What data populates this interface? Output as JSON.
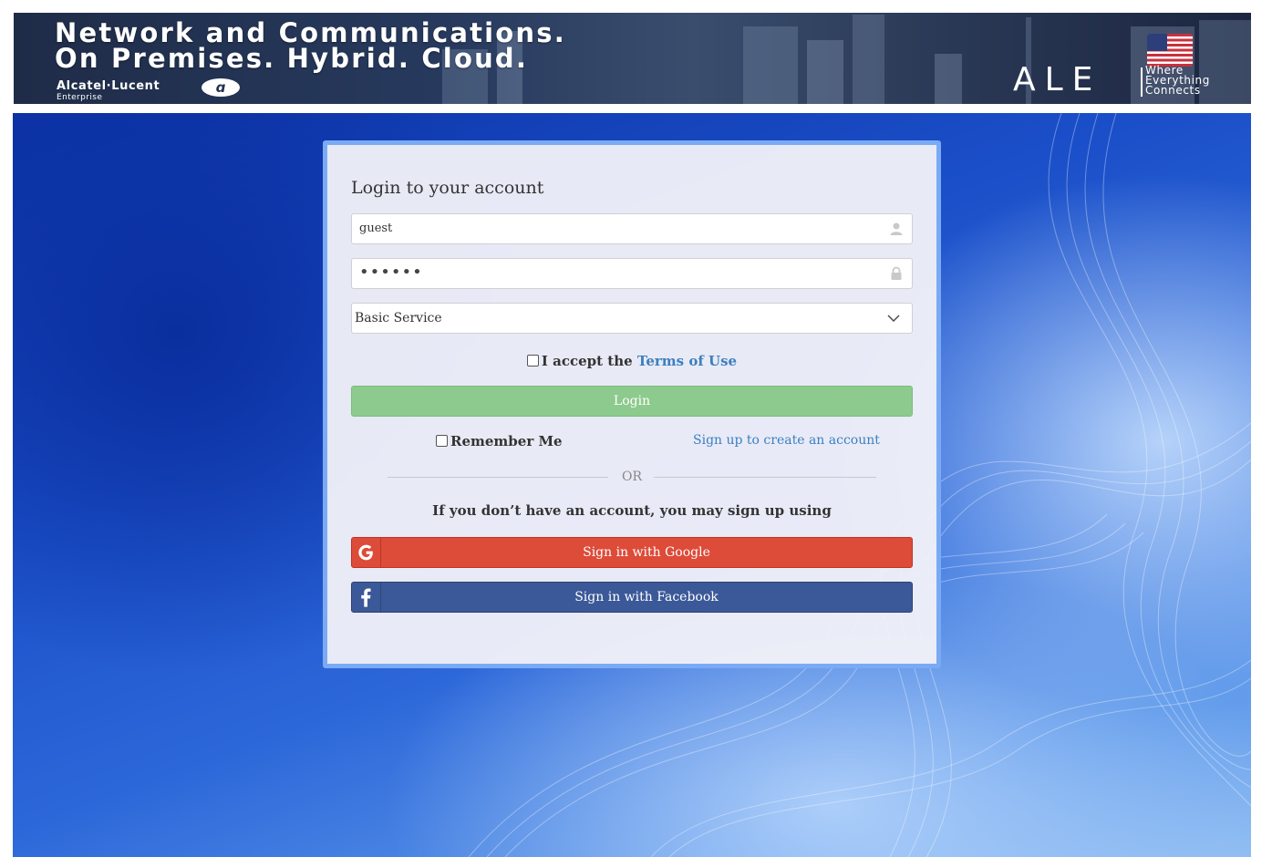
{
  "banner": {
    "headline_line1": "Network and Communications.",
    "headline_line2": "On Premises. Hybrid. Cloud.",
    "brand_name": "Alcatel·Lucent",
    "brand_sub": "Enterprise",
    "ale_logo": "ALE",
    "tagline_1": "Where",
    "tagline_2": "Everything",
    "tagline_3": "Connects",
    "flag_icon": "us-flag-icon"
  },
  "login": {
    "title": "Login to your account",
    "username_value": "guest",
    "username_icon": "user-icon",
    "password_value": "••••••",
    "password_icon": "lock-icon",
    "service_selected": "Basic Service",
    "terms_prefix": "I accept the",
    "terms_link": "Terms of Use",
    "login_button": "Login",
    "remember_me": "Remember Me",
    "signup_link": "Sign up to create an account",
    "or_text": "OR",
    "signup_note": "If you don’t have an account, you may sign up using",
    "google_button": "Sign in with Google",
    "facebook_button": "Sign in with Facebook"
  },
  "colors": {
    "accent_link": "#3d7fbf",
    "login_button": "#8dca8d",
    "google": "#dd4b39",
    "facebook": "#3b5998",
    "card_border": "#7aaaf4"
  }
}
